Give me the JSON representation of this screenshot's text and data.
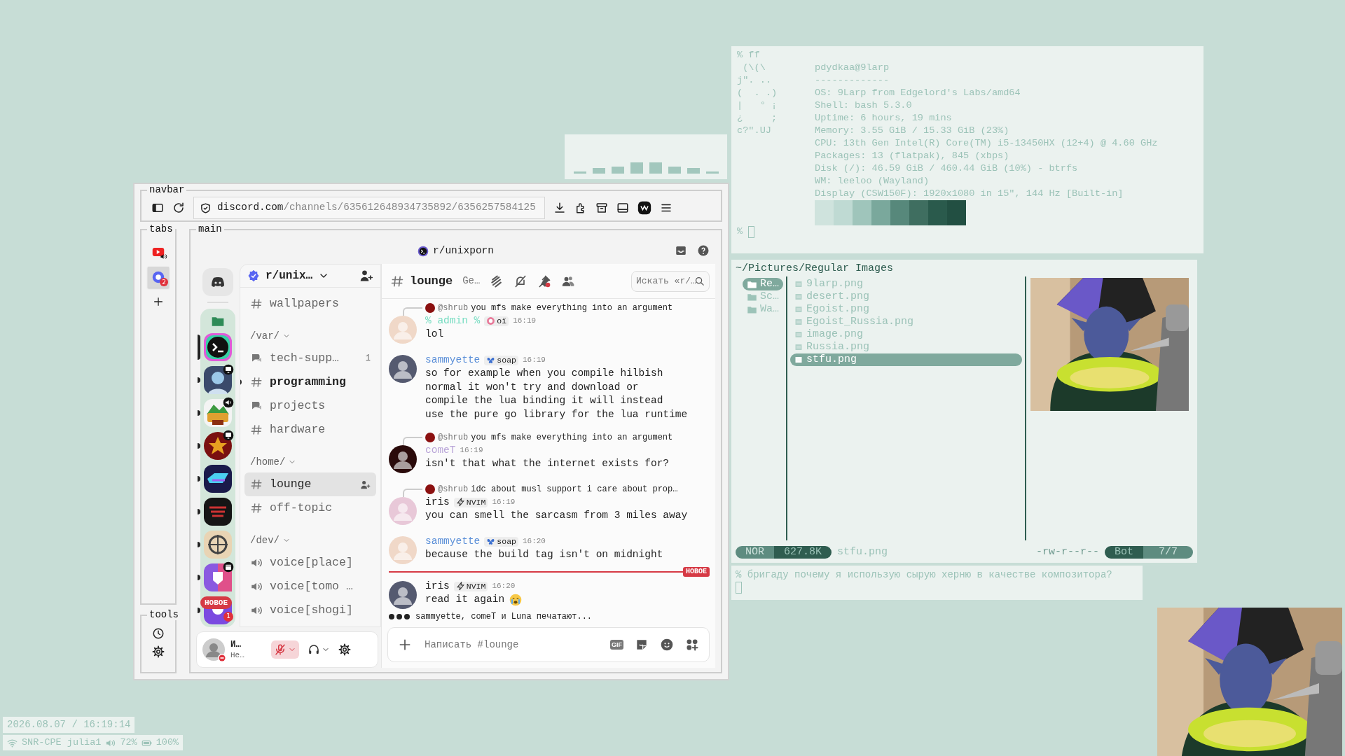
{
  "browser": {
    "frames": {
      "navbar": "navbar",
      "tabs": "tabs",
      "main": "main",
      "tools": "tools"
    },
    "url": {
      "host": "discord.com",
      "path": "/channels/635612648934735892/6356257584125"
    },
    "tabs": [
      {
        "audio": true,
        "selected": false
      },
      {
        "audio": false,
        "selected": true,
        "badge": "2"
      }
    ],
    "discord": {
      "server_title": "r/unixporn",
      "guild": "r/unix…",
      "servers": [
        {
          "kind": "plain",
          "selected": true,
          "unread": false
        },
        {
          "kind": "screen",
          "selected": false,
          "unread": true
        },
        {
          "kind": "voice",
          "selected": false,
          "unread": true
        },
        {
          "kind": "screen",
          "selected": false,
          "unread": true
        },
        {
          "kind": "plain",
          "selected": false,
          "unread": true
        },
        {
          "kind": "plain",
          "selected": false,
          "unread": true
        },
        {
          "kind": "plain",
          "selected": false,
          "unread": true
        },
        {
          "kind": "event",
          "selected": false,
          "unread": true
        },
        {
          "kind": "plain",
          "selected": false,
          "unread": true,
          "mentions": "1"
        }
      ],
      "new_pill": "НОВОЕ",
      "channels": [
        {
          "kind": "text",
          "name": "wallpapers",
          "selected": false,
          "unread": false
        },
        {
          "kind": "category",
          "name": "/var/",
          "expanded": true,
          "children": [
            {
              "kind": "forum",
              "name": "tech-supp…",
              "badge": "1",
              "selected": false,
              "unread": false
            },
            {
              "kind": "text",
              "name": "programming",
              "selected": false,
              "unread": true
            },
            {
              "kind": "forum",
              "name": "projects",
              "selected": false,
              "unread": false
            },
            {
              "kind": "text",
              "name": "hardware",
              "selected": false,
              "unread": false
            }
          ]
        },
        {
          "kind": "category",
          "name": "/home/",
          "expanded": true,
          "children": [
            {
              "kind": "text",
              "name": "lounge",
              "selected": true,
              "unread": false
            },
            {
              "kind": "text",
              "name": "off-topic",
              "selected": false,
              "unread": false
            }
          ]
        },
        {
          "kind": "category",
          "name": "/dev/",
          "expanded": true,
          "children": [
            {
              "kind": "voice",
              "name": "voice[place]",
              "selected": false,
              "unread": false
            },
            {
              "kind": "voice",
              "name": "voice[tomo …",
              "selected": false,
              "unread": false
            },
            {
              "kind": "voice",
              "name": "voice[shogi]",
              "selected": false,
              "unread": false
            }
          ]
        }
      ],
      "user": {
        "name": "И…",
        "status": "Не…",
        "muted": true
      },
      "chat": {
        "channel": "lounge",
        "topic": "Ge…",
        "search_placeholder": "Искать «r/…",
        "messages": [
          {
            "kind": "plain",
            "reply": {
              "author": "@shrub",
              "text": "you mfs make everything into an argument"
            },
            "author": "% admin %",
            "color": "#74dcc0",
            "tag": {
              "kind": "badge",
              "label": "oï"
            },
            "time": "16:19",
            "lines": [
              "lol"
            ],
            "new_divider": false
          },
          {
            "kind": "plain",
            "author": "sammyette",
            "color": "#5b8fd8",
            "tag": {
              "kind": "butterfly",
              "label": "soap"
            },
            "time": "16:19",
            "lines": [
              "so for example when you compile hilbish",
              "normal it won't try and download or",
              "compile the lua binding it will instead",
              "use the pure go library for the lua runtime"
            ],
            "new_divider": false
          },
          {
            "kind": "plain",
            "reply": {
              "author": "@shrub",
              "text": "you mfs make everything into an argument"
            },
            "author": "comeT",
            "color": "#b9a5d8",
            "time": "16:19",
            "lines": [
              "isn't that what the internet exists for?"
            ],
            "new_divider": false
          },
          {
            "kind": "plain",
            "reply": {
              "author": "@shrub",
              "text": "idc about musl support i care about prop…"
            },
            "author": "iris",
            "color": "#222222",
            "tag": {
              "kind": "bolt",
              "label": "NVIM"
            },
            "time": "16:19",
            "lines": [
              "you can smell the sarcasm from 3 miles away"
            ],
            "new_divider": false
          },
          {
            "kind": "plain",
            "author": "sammyette",
            "color": "#5b8fd8",
            "tag": {
              "kind": "butterfly",
              "label": "soap"
            },
            "time": "16:20",
            "lines": [
              "because the build tag isn't on midnight"
            ],
            "new_divider": false
          },
          {
            "kind": "emoji",
            "author": "iris",
            "color": "#222222",
            "tag": {
              "kind": "bolt",
              "label": "NVIM"
            },
            "time": "16:20",
            "lines": [
              "read it again"
            ],
            "new_divider": true
          }
        ],
        "new_label": "НОВОЕ",
        "typing": "sammyette, comeT и Luna печатают...",
        "composer_placeholder": "Написать #lounge",
        "gif_label": "GIF"
      }
    }
  },
  "fetch": {
    "prompt": "%",
    "command": "ff",
    "art": [
      " (\\(\\",
      "j\". ..",
      "(  . .)",
      "|   ° ¡",
      "¿     ;",
      "c?\".UJ"
    ],
    "title": "pdydkaa@9larp",
    "separator": "-------------",
    "info": [
      "OS: 9Larp from Edgelord's Labs/amd64",
      "Shell: bash 5.3.0",
      "Uptime: 6 hours, 19 mins",
      "Memory: 3.55 GiB / 15.33 GiB (23%)",
      "CPU: 13th Gen Intel(R) Core(TM) i5-13450HX (12+4) @ 4.60 GHz",
      "Packages: 13 (flatpak), 845 (xbps)",
      "Disk (/): 46.59 GiB / 460.44 GiB (10%) - btrfs",
      "WM: leeloo (Wayland)",
      "Display (CSW150F): 1920x1080 in 15\", 144 Hz [Built-in]"
    ],
    "palette": [
      {
        "color": "#cfe3dd"
      },
      {
        "color": "#bfdad3"
      },
      {
        "color": "#9fc5bb"
      },
      {
        "color": "#7aa89c"
      },
      {
        "color": "#57887b"
      },
      {
        "color": "#3f6e60"
      },
      {
        "color": "#2a5a4c"
      },
      {
        "color": "#224f42"
      }
    ],
    "next_prompt": "%"
  },
  "files": {
    "path": "~/Pictures/Regular Images",
    "parents": [
      {
        "name": "Re…",
        "selected": true
      },
      {
        "name": "Sc…",
        "selected": false
      },
      {
        "name": "Wa…",
        "selected": false
      }
    ],
    "entries": [
      {
        "name": "9larp.png",
        "selected": false
      },
      {
        "name": "desert.png",
        "selected": false
      },
      {
        "name": "Egoist.png",
        "selected": false
      },
      {
        "name": "Egoist_Russia.png",
        "selected": false
      },
      {
        "name": "image.png",
        "selected": false
      },
      {
        "name": "Russia.png",
        "selected": false
      },
      {
        "name": "stfu.png",
        "selected": true
      }
    ],
    "status": {
      "mode": "NOR",
      "size": "627.8K",
      "file": "stfu.png",
      "perms": "-rw-r--r--",
      "position": "Bot",
      "count": "7/7"
    }
  },
  "shell": {
    "prompt": "%",
    "text": "бригаду почему я использую сырую херню в качестве композитора?"
  },
  "bar": {
    "clock": "2026.08.07 / 16:19:14",
    "network": "SNR-CPE julia1",
    "volume": "72%",
    "battery": "100%"
  }
}
